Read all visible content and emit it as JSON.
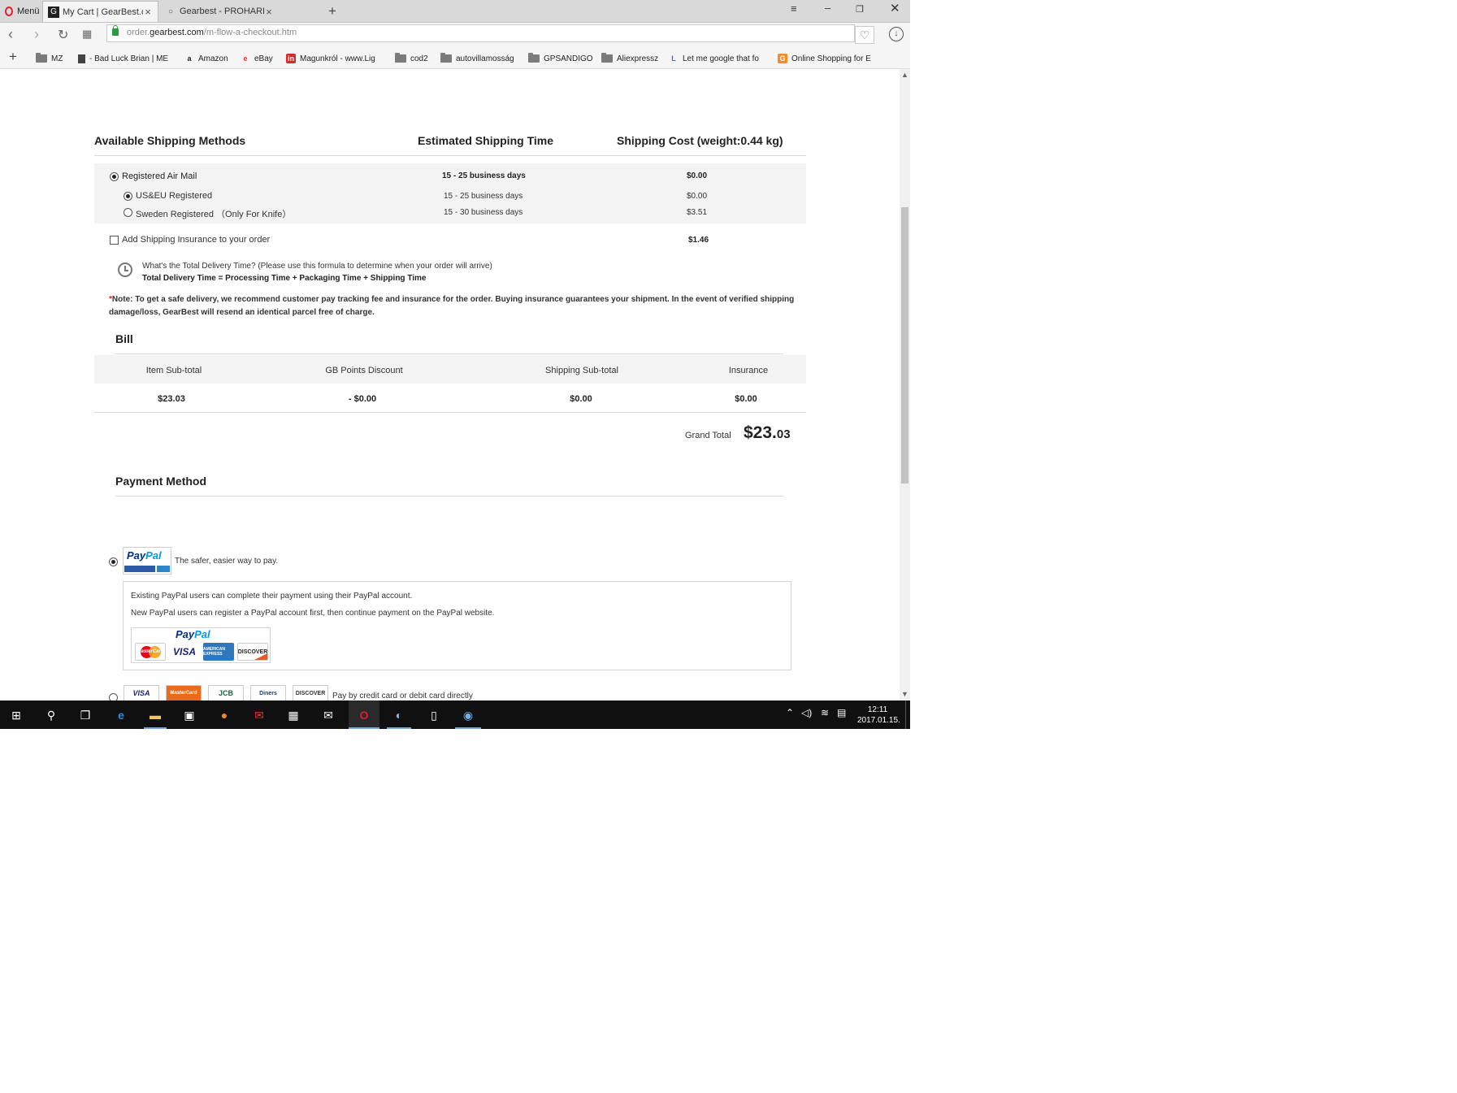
{
  "browser": {
    "menu_label": "Menü",
    "tabs": [
      {
        "title": "My Cart | GearBest.com",
        "active": true
      },
      {
        "title": "Gearbest - PROHARDVER!",
        "active": false
      }
    ],
    "url_prefix": "order.",
    "url_domain": "gearbest.com",
    "url_path": "/m-flow-a-checkout.htm",
    "bookmarks": [
      "MZ",
      "- Bad Luck Brian | ME",
      "Amazon",
      "eBay",
      "Magunkról - www.Lig",
      "cod2",
      "autovillamosság",
      "GPSANDIGO",
      "Aliexpressz",
      "Let me google that fo",
      "Online Shopping for E"
    ]
  },
  "shipping": {
    "header_method": "Available Shipping Methods",
    "header_time": "Estimated Shipping Time",
    "header_cost": "Shipping Cost (weight:0.44 kg)",
    "method_main": {
      "name": "Registered Air Mail",
      "time": "15 - 25 business days",
      "cost": "$0.00"
    },
    "options": [
      {
        "name": "US&EU Registered",
        "time": "15 - 25 business days",
        "cost": "$0.00",
        "selected": true
      },
      {
        "name": "Sweden Registered （Only For Knife）",
        "time": "15 - 30 business days",
        "cost": "$3.51",
        "selected": false
      }
    ],
    "insurance_label": "Add Shipping Insurance to your order",
    "insurance_cost": "$1.46",
    "delivery_question": "What's the Total Delivery Time? (Please use this formula to determine when your order will arrive)",
    "delivery_formula": "Total Delivery Time = Processing Time + Packaging Time + Shipping Time",
    "note_star": "*",
    "note_text": "Note: To get a safe delivery, we recommend customer pay tracking fee and insurance for the order. Buying insurance guarantees your shipment. In the event of verified shipping damage/loss, GearBest will resend an identical parcel free of charge."
  },
  "bill": {
    "title": "Bill",
    "columns": [
      "Item Sub-total",
      "GB Points Discount",
      "Shipping Sub-total",
      "Insurance"
    ],
    "values": [
      "$23.03",
      "- $0.00",
      "$0.00",
      "$0.00"
    ],
    "grand_total_label": "Grand Total",
    "grand_total_main": "$23.",
    "grand_total_cents": "03"
  },
  "payment": {
    "title": "Payment Method",
    "paypal_tagline": "The safer, easier way to pay.",
    "paypal_line1": "Existing PayPal users can complete their payment using their PayPal account.",
    "paypal_line2": "New PayPal users can register a PayPal account first, then continue payment on the PayPal website.",
    "paypal_logo_text_a": "Pay",
    "paypal_logo_text_b": "Pal",
    "card_labels": [
      "MasterCard",
      "VISA",
      "AMERICAN EXPRESS",
      "DISCOVER"
    ],
    "credit_label": "Pay by credit card or debit card directly",
    "credit_card_labels": [
      "VISA",
      "MasterCard",
      "JCB",
      "Diners",
      "DISCOVER"
    ]
  },
  "taskbar": {
    "time": "12:11",
    "date": "2017.01.15."
  },
  "colors": {
    "accent_red": "#e02020",
    "paypal_blue": "#003087",
    "paypal_light": "#009cde",
    "gray_row": "#f3f3f3"
  }
}
